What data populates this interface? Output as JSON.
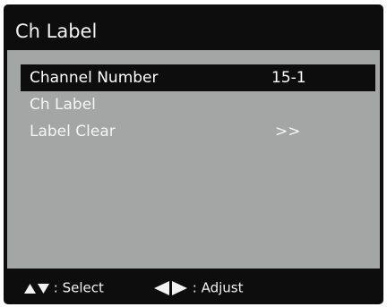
{
  "title": "Ch Label",
  "menu": {
    "items": [
      {
        "label": "Channel Number",
        "value": "15-1",
        "selected": true
      },
      {
        "label": "Ch Label",
        "value": "",
        "selected": false
      },
      {
        "label": "Label Clear",
        "value": ">>",
        "selected": false
      }
    ]
  },
  "footer": {
    "select_icon": "up-down-triangle-icon",
    "select_label": ": Select",
    "adjust_icon": "left-right-triangle-icon",
    "adjust_label": ": Adjust"
  },
  "colors": {
    "frame": "#0d0d0d",
    "panel": "#a4a6a6",
    "text": "#f4f4f4",
    "highlight": "#0d0d0d"
  }
}
